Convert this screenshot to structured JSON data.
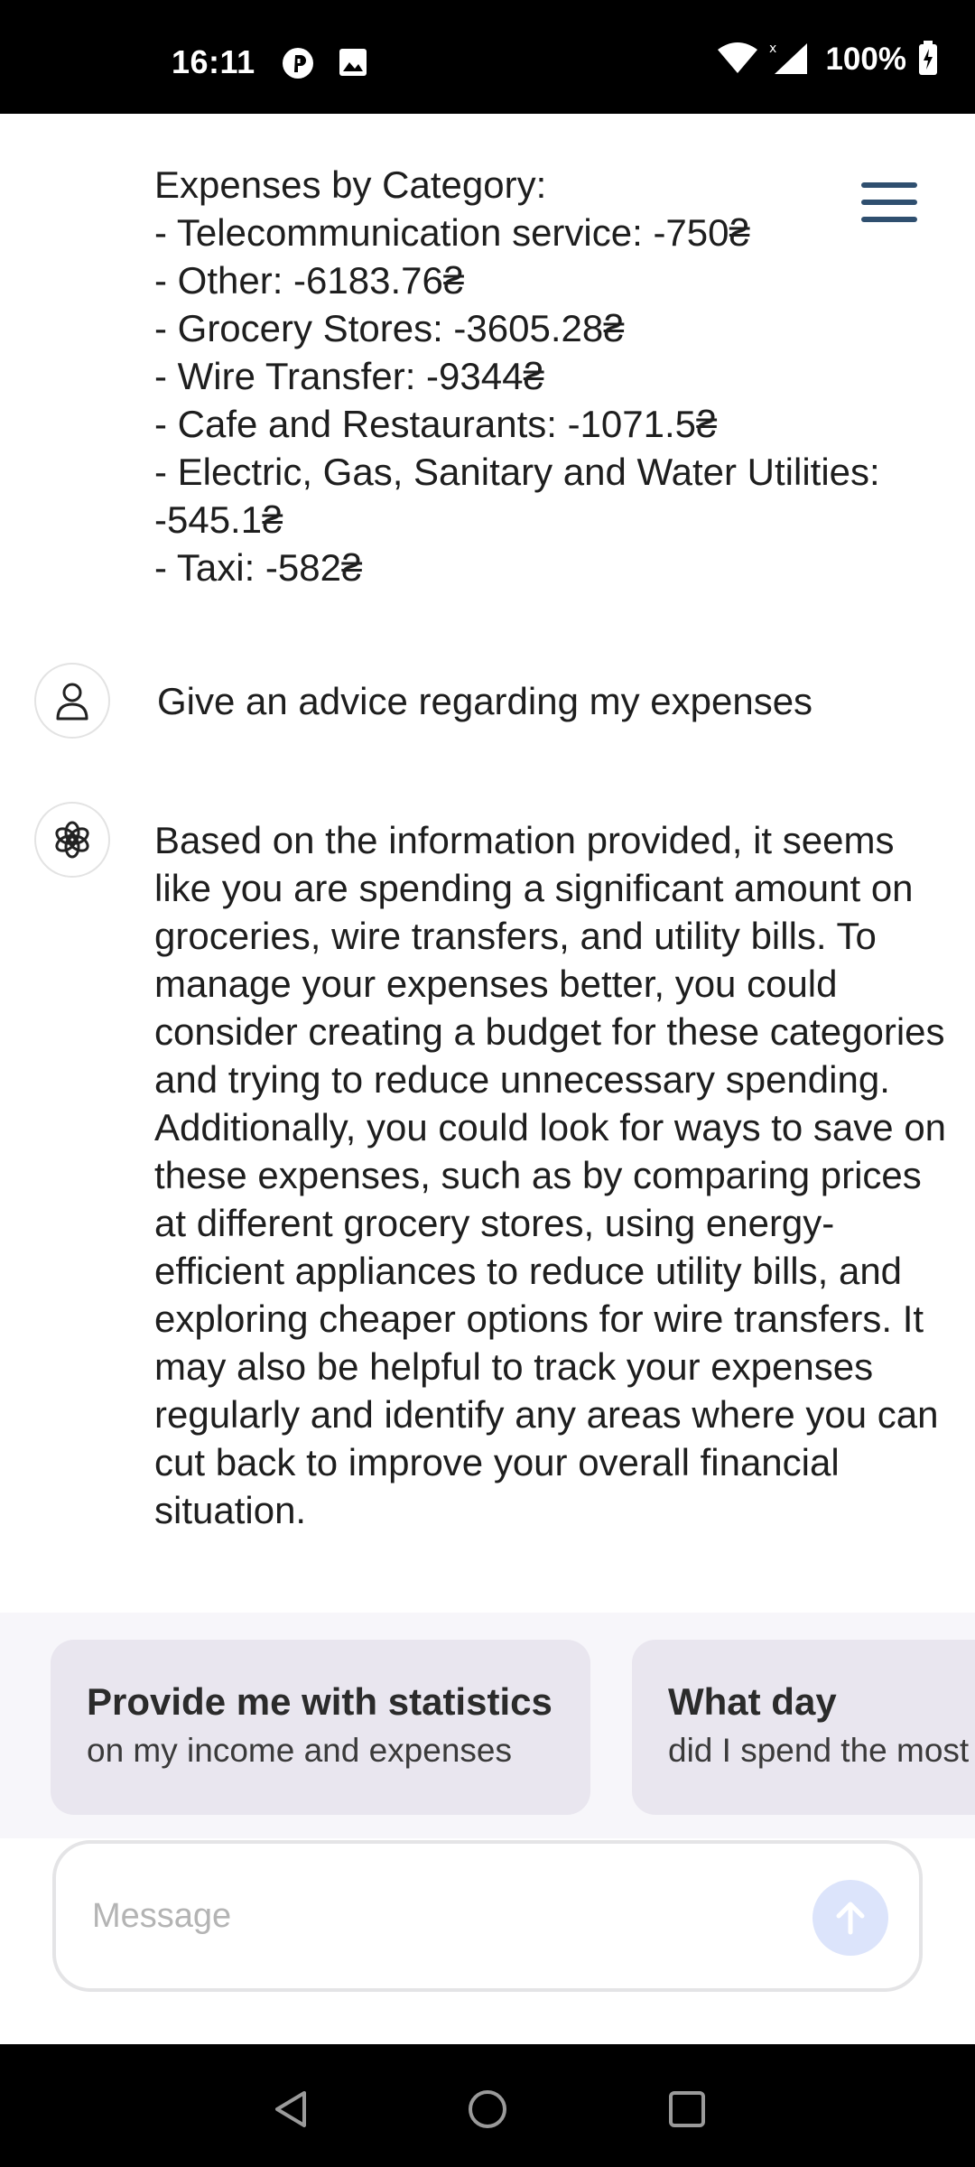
{
  "status_bar": {
    "time": "16:11",
    "battery": "100%",
    "icons": [
      "pinterest-icon",
      "image-icon",
      "wifi-icon",
      "signal-icon",
      "battery-charging-icon"
    ]
  },
  "chat": {
    "summary_message": "Expenses by Category:\n- Telecommunication service: -750₴\n- Other: -6183.76₴\n- Grocery Stores: -3605.28₴\n- Wire Transfer: -9344₴\n- Cafe and Restaurants: -1071.5₴\n- Electric, Gas, Sanitary and Water Utilities:\n-545.1₴\n- Taxi: -582₴",
    "user_message": "Give an advice regarding my expenses",
    "assistant_message": "Based on the information provided, it seems like you are spending a significant amount on groceries, wire transfers, and utility bills. To manage your expenses better, you could consider creating a budget for these categories and trying to reduce unnecessary spending. Additionally, you could look for ways to save on these expenses, such as by comparing prices at different grocery stores, using energy-efficient appliances to reduce utility bills, and exploring cheaper options for wire transfers. It may also be helpful to track your expenses regularly and identify any areas where you can cut back to improve your overall financial situation."
  },
  "suggestions": [
    {
      "title": "Provide me with statistics",
      "subtitle": "on my income and expenses"
    },
    {
      "title": "What day",
      "subtitle": "did I spend the most"
    }
  ],
  "input": {
    "placeholder": "Message"
  },
  "colors": {
    "menu": "#2f4f6f",
    "send_button_bg": "#dce4fb",
    "suggestion_bg": "#e9e6ef"
  }
}
